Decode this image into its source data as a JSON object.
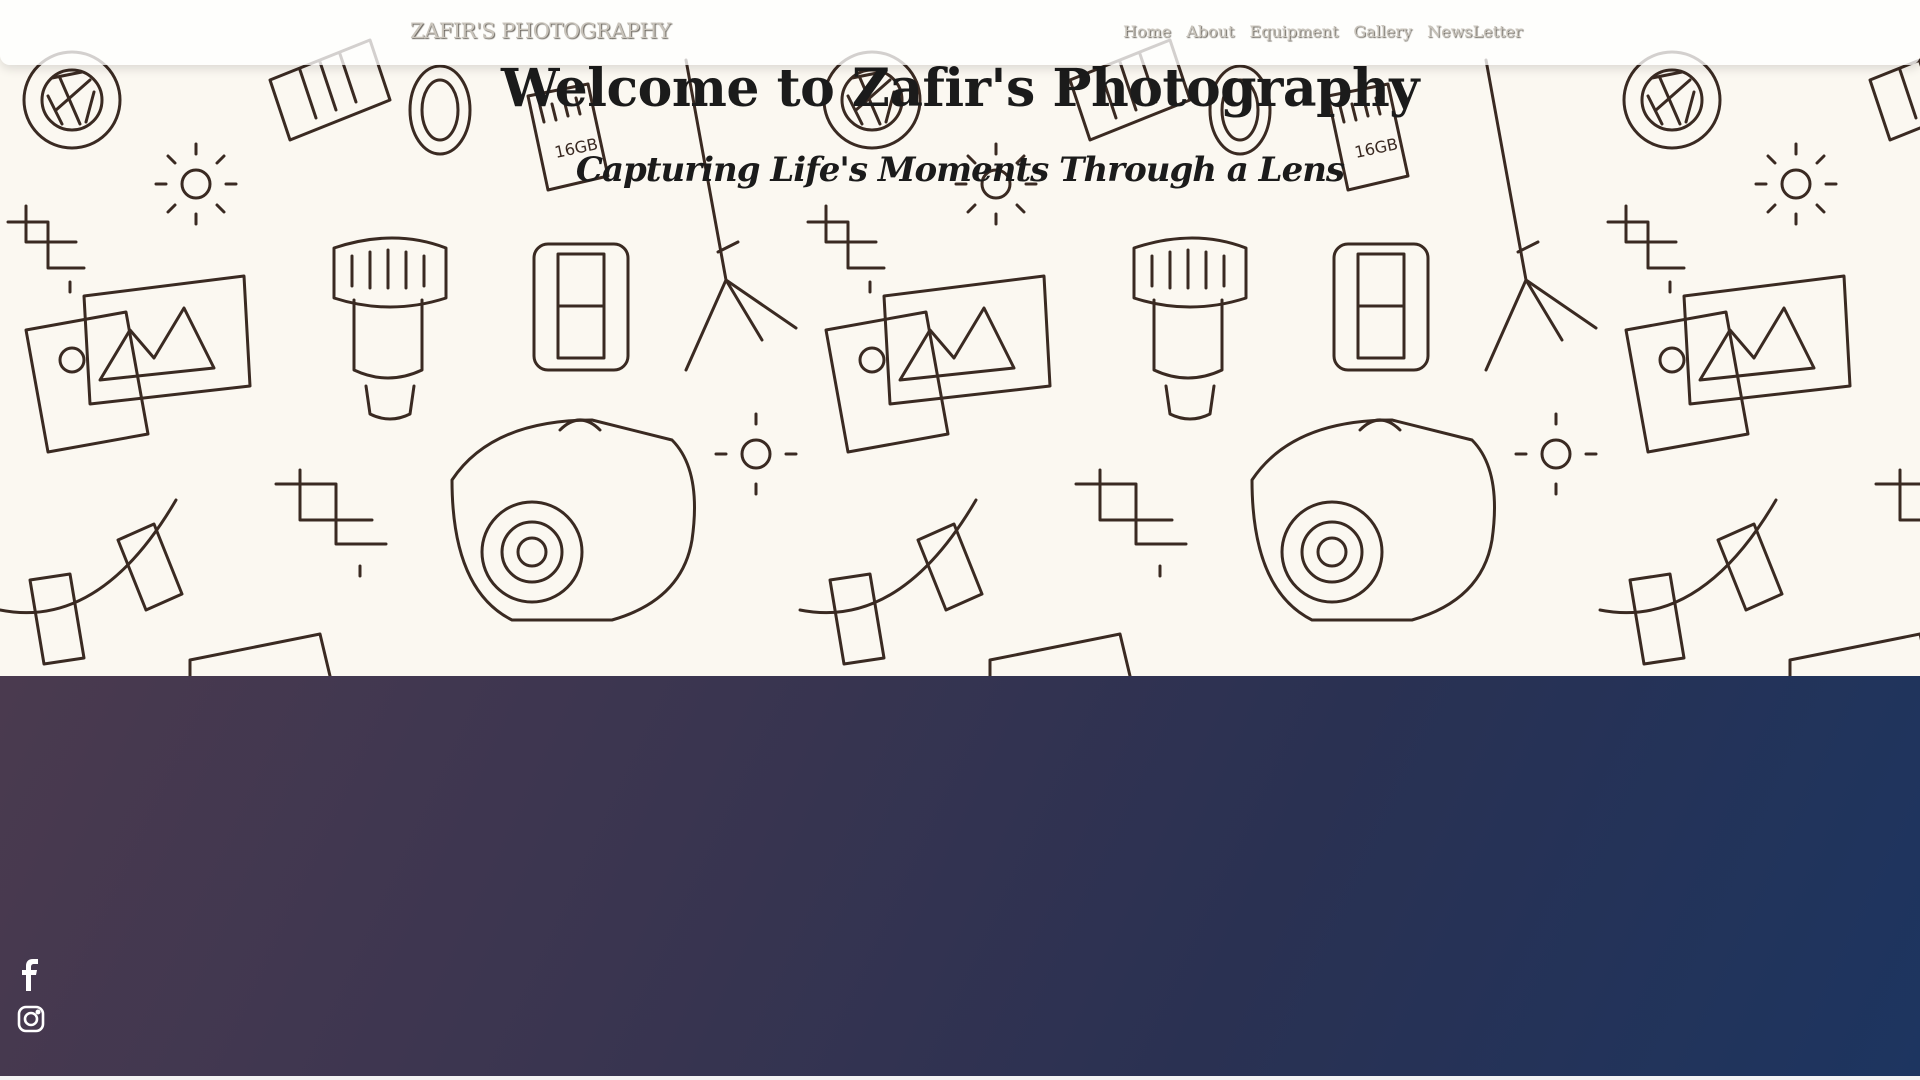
{
  "navbar": {
    "brand": "ZAFIR'S PHOTOGRAPHY",
    "links": [
      {
        "label": "Home"
      },
      {
        "label": "About"
      },
      {
        "label": "Equipment"
      },
      {
        "label": "Gallery"
      },
      {
        "label": "NewsLetter"
      }
    ]
  },
  "hero": {
    "title": "Welcome to Zafir's Photography",
    "subtitle": "Capturing Life's Moments Through a Lens",
    "background_pattern_text": "16GB"
  },
  "social": [
    {
      "icon": "facebook-icon"
    },
    {
      "icon": "instagram-icon"
    }
  ],
  "colors": {
    "hero_bg": "#fbf8f1",
    "doodle_stroke": "#3a2a22",
    "nav_text": "#c9c4bb",
    "gradient_start": "#4a3a4f",
    "gradient_end": "#1d3560"
  }
}
